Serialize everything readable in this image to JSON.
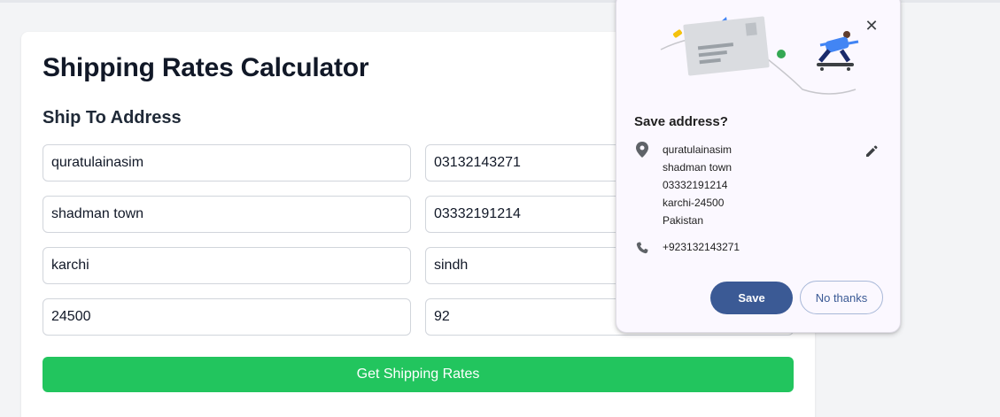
{
  "form": {
    "title": "Shipping Rates Calculator",
    "section_title": "Ship To Address",
    "fields": {
      "name": "quratulainasim",
      "phone": "03132143271",
      "street": "shadman town",
      "alt_phone": "03332191214",
      "city": "karchi",
      "state": "sindh",
      "postal_code": "24500",
      "country_code": "92"
    },
    "submit_label": "Get Shipping Rates",
    "submit_color": "#22c55e"
  },
  "popup": {
    "title": "Save address?",
    "close_icon": "close-icon",
    "address_lines": {
      "line1": "quratulainasim",
      "line2": "shadman town",
      "line3": "03332191214",
      "line4": "karchi-24500",
      "line5": "Pakistan"
    },
    "phone": "+923132143271",
    "save_label": "Save",
    "no_thanks_label": "No thanks",
    "accent_color": "#3b5a95"
  }
}
